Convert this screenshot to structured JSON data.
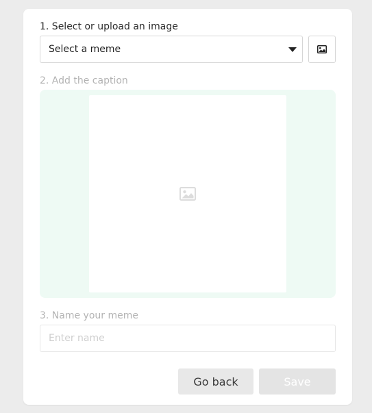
{
  "steps": {
    "select": {
      "label": "1. Select or upload an image",
      "select_value": "Select a meme",
      "upload_icon": "image-icon"
    },
    "caption": {
      "label": "2. Add the caption",
      "placeholder_icon": "image-placeholder-icon",
      "area_color": "#eefaf4"
    },
    "name": {
      "label": "3. Name your meme",
      "placeholder": "Enter name",
      "value": ""
    }
  },
  "actions": {
    "back_label": "Go back",
    "save_label": "Save"
  }
}
